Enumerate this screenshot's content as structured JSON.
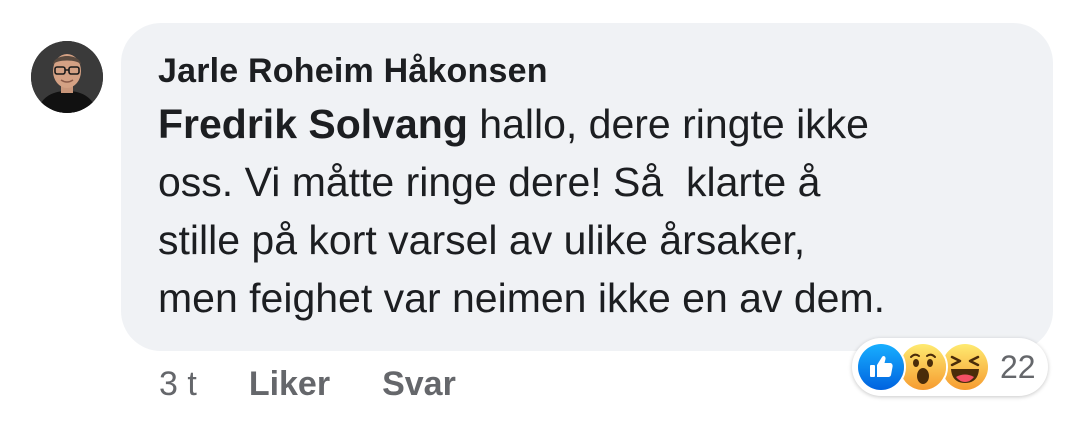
{
  "comment": {
    "author": "Jarle Roheim Håkonsen",
    "mention": "Fredrik Solvang",
    "text": " hallo, dere ringte ikke\noss. Vi måtte ringe dere! Så  klarte å\nstille på kort varsel av ulike årsaker,\nmen feighet var neimen ikke en av dem.",
    "timestamp": "3 t",
    "like_label": "Liker",
    "reply_label": "Svar"
  },
  "reactions": {
    "icons": [
      "like-icon",
      "wow-icon",
      "haha-icon"
    ],
    "count": "22"
  },
  "colors": {
    "bubble_bg": "#f0f2f5",
    "text": "#1c1e21",
    "secondary_text": "#65676b",
    "like_blue": "#1877f2",
    "emoji_yellow": "#f7b928"
  }
}
